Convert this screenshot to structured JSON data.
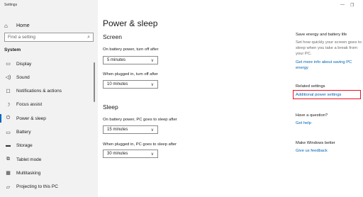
{
  "app": {
    "title": "Settings"
  },
  "window": {
    "minimize": "—",
    "restore": "❐"
  },
  "sidebar": {
    "home": {
      "label": "Home",
      "icon": "home-icon"
    },
    "search_placeholder": "Find a setting",
    "group": "System",
    "items": [
      {
        "label": "Display",
        "icon": "display-icon",
        "glyph": "▭"
      },
      {
        "label": "Sound",
        "icon": "sound-icon",
        "glyph": "◁)"
      },
      {
        "label": "Notifications & actions",
        "icon": "notifications-icon",
        "glyph": "☐"
      },
      {
        "label": "Focus assist",
        "icon": "focus-assist-icon",
        "glyph": "☽"
      },
      {
        "label": "Power & sleep",
        "icon": "power-icon",
        "glyph": "⏻",
        "active": true
      },
      {
        "label": "Battery",
        "icon": "battery-icon",
        "glyph": "▭"
      },
      {
        "label": "Storage",
        "icon": "storage-icon",
        "glyph": "▬"
      },
      {
        "label": "Tablet mode",
        "icon": "tablet-mode-icon",
        "glyph": "⧉"
      },
      {
        "label": "Multitasking",
        "icon": "multitasking-icon",
        "glyph": "▦"
      },
      {
        "label": "Projecting to this PC",
        "icon": "projecting-icon",
        "glyph": "▱"
      }
    ]
  },
  "main": {
    "title": "Power & sleep",
    "screen": {
      "heading": "Screen",
      "battery_label": "On battery power, turn off after",
      "battery_value": "5 minutes",
      "plugged_label": "When plugged in, turn off after",
      "plugged_value": "10 minutes"
    },
    "sleep": {
      "heading": "Sleep",
      "battery_label": "On battery power, PC goes to sleep after",
      "battery_value": "15 minutes",
      "plugged_label": "When plugged in, PC goes to sleep after",
      "plugged_value": "30 minutes"
    }
  },
  "right": {
    "save_title": "Save energy and battery life",
    "save_text": "Set how quickly your screen goes to sleep when you take a break from your PC.",
    "save_link": "Get more info about saving PC energy",
    "related_title": "Related settings",
    "related_link": "Additional power settings",
    "question_title": "Have a question?",
    "help_link": "Get help",
    "better_title": "Make Windows better",
    "feedback_link": "Give us feedback"
  }
}
